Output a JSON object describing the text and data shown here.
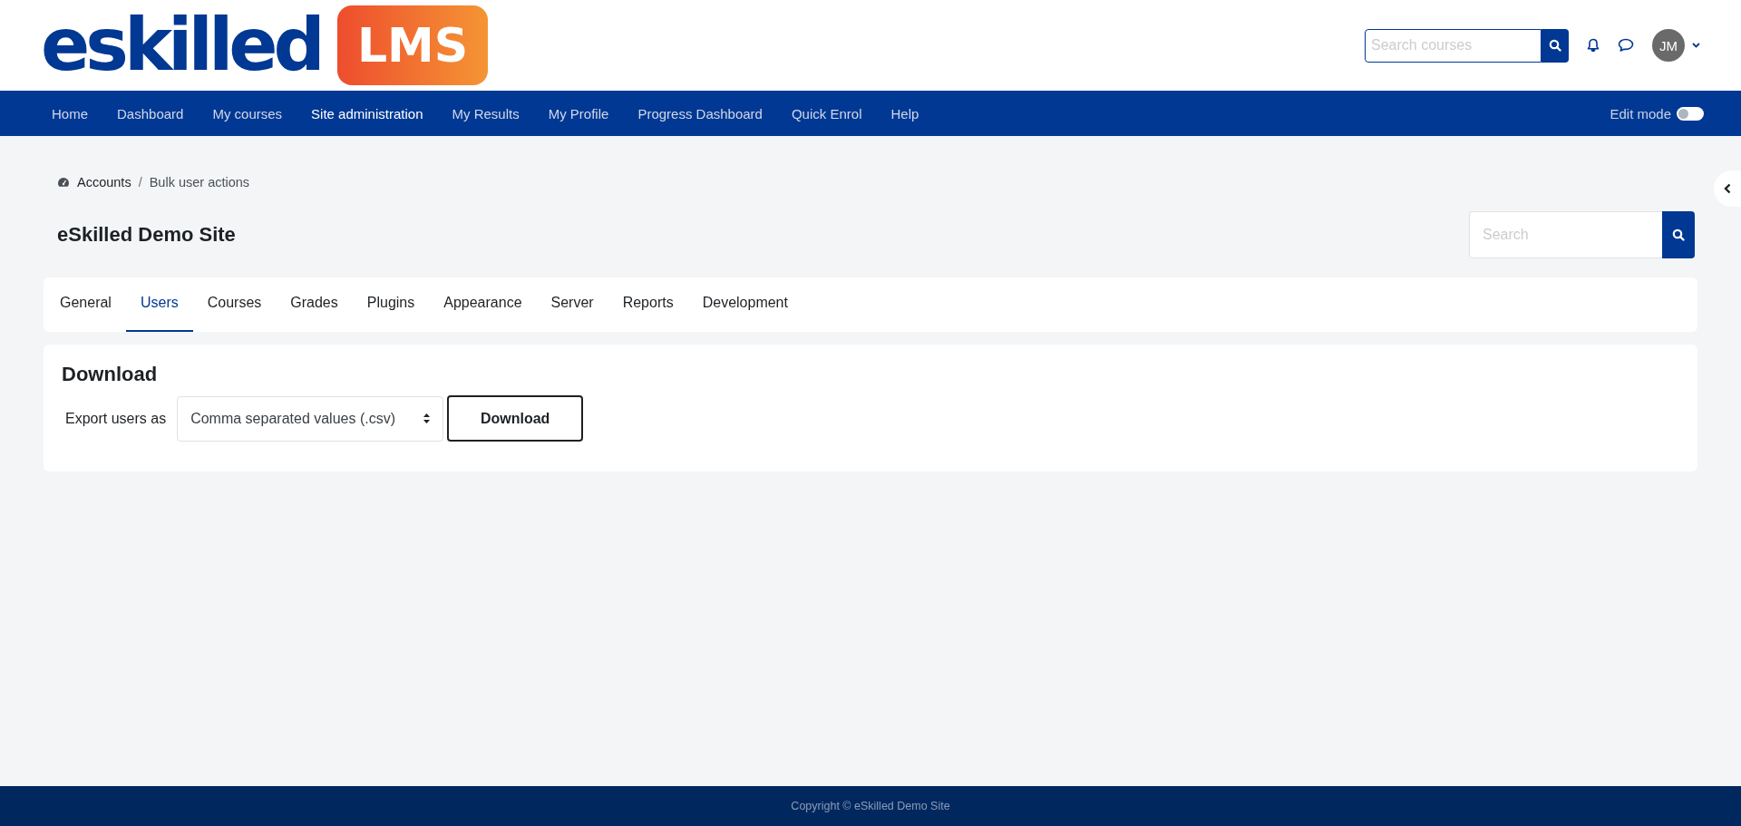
{
  "logo": {
    "wordmark": "eskilled",
    "badge": "LMS"
  },
  "header": {
    "search": {
      "placeholder": "Search courses"
    },
    "avatar": "JM"
  },
  "nav": {
    "items": [
      {
        "label": "Home",
        "selected": false
      },
      {
        "label": "Dashboard",
        "selected": false
      },
      {
        "label": "My courses",
        "selected": false
      },
      {
        "label": "Site administration",
        "selected": true
      },
      {
        "label": "My Results",
        "selected": false
      },
      {
        "label": "My Profile",
        "selected": false
      },
      {
        "label": "Progress Dashboard",
        "selected": false
      },
      {
        "label": "Quick Enrol",
        "selected": false
      },
      {
        "label": "Help",
        "selected": false
      }
    ],
    "edit_mode": {
      "label": "Edit mode",
      "on": false
    }
  },
  "breadcrumb": {
    "items": [
      "Accounts",
      "Bulk user actions"
    ],
    "separator": "/"
  },
  "page_title": "eSkilled Demo Site",
  "page_search": {
    "placeholder": "Search"
  },
  "tabs": [
    {
      "label": "General",
      "selected": false
    },
    {
      "label": "Users",
      "selected": true
    },
    {
      "label": "Courses",
      "selected": false
    },
    {
      "label": "Grades",
      "selected": false
    },
    {
      "label": "Plugins",
      "selected": false
    },
    {
      "label": "Appearance",
      "selected": false
    },
    {
      "label": "Server",
      "selected": false
    },
    {
      "label": "Reports",
      "selected": false
    },
    {
      "label": "Development",
      "selected": false
    }
  ],
  "download": {
    "heading": "Download",
    "label": "Export users as",
    "format": "Comma separated values (.csv)",
    "button": "Download"
  },
  "footer": "Copyright © eSkilled Demo Site"
}
